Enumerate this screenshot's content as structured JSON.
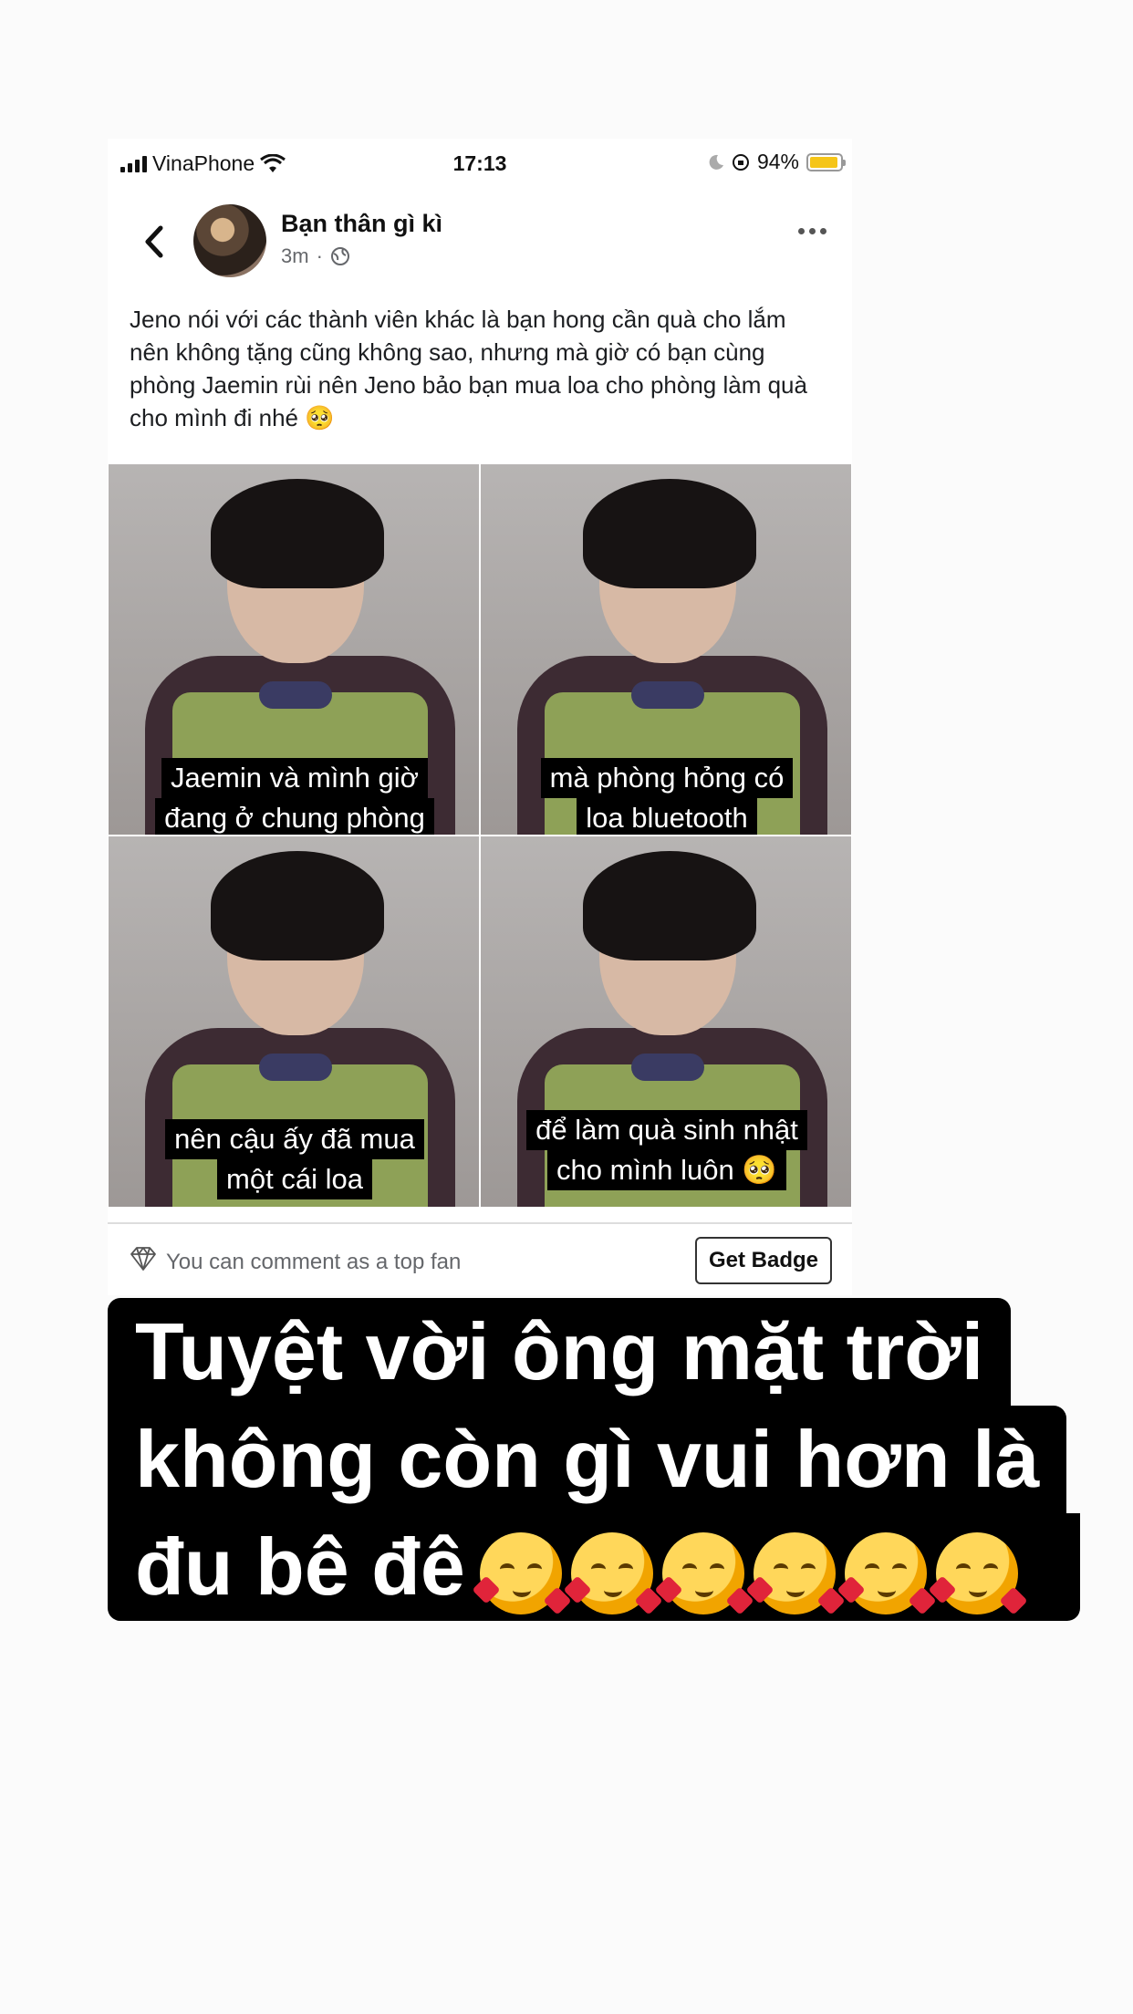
{
  "status_bar": {
    "carrier": "VinaPhone",
    "time": "17:13",
    "battery": "94%",
    "battery_level": 0.94,
    "battery_color": "#f5c518"
  },
  "post": {
    "page_name": "Bạn thân gì kì",
    "time_ago": "3m",
    "separator": "·",
    "text": "Jeno nói với các thành viên khác là bạn hong cần quà cho lắm nên không tặng cũng không sao, nhưng mà giờ có bạn cùng phòng Jaemin rùi nên Jeno bảo bạn mua loa cho phòng làm quà cho mình đi nhé 🥺",
    "images": [
      {
        "caption_line1": "Jaemin và mình giờ",
        "caption_line2": "đang ở chung phòng"
      },
      {
        "caption_line1": "mà phòng hỏng có",
        "caption_line2": "loa bluetooth"
      },
      {
        "caption_line1": "nên cậu ấy đã mua",
        "caption_line2": "một cái loa"
      },
      {
        "caption_line1": "để làm quà sinh nhật",
        "caption_line2": "cho mình luôn 🥺"
      }
    ]
  },
  "comment_bar": {
    "text": "You can comment as a top fan",
    "button": "Get Badge"
  },
  "story_overlay": {
    "line1": "Tuyệt vời ông mặt trời",
    "line2": "không còn gì vui hơn là",
    "line3": "đu bê đê",
    "emoji_icon": "smiling-face-with-hearts-icon",
    "emoji_count": 6
  }
}
